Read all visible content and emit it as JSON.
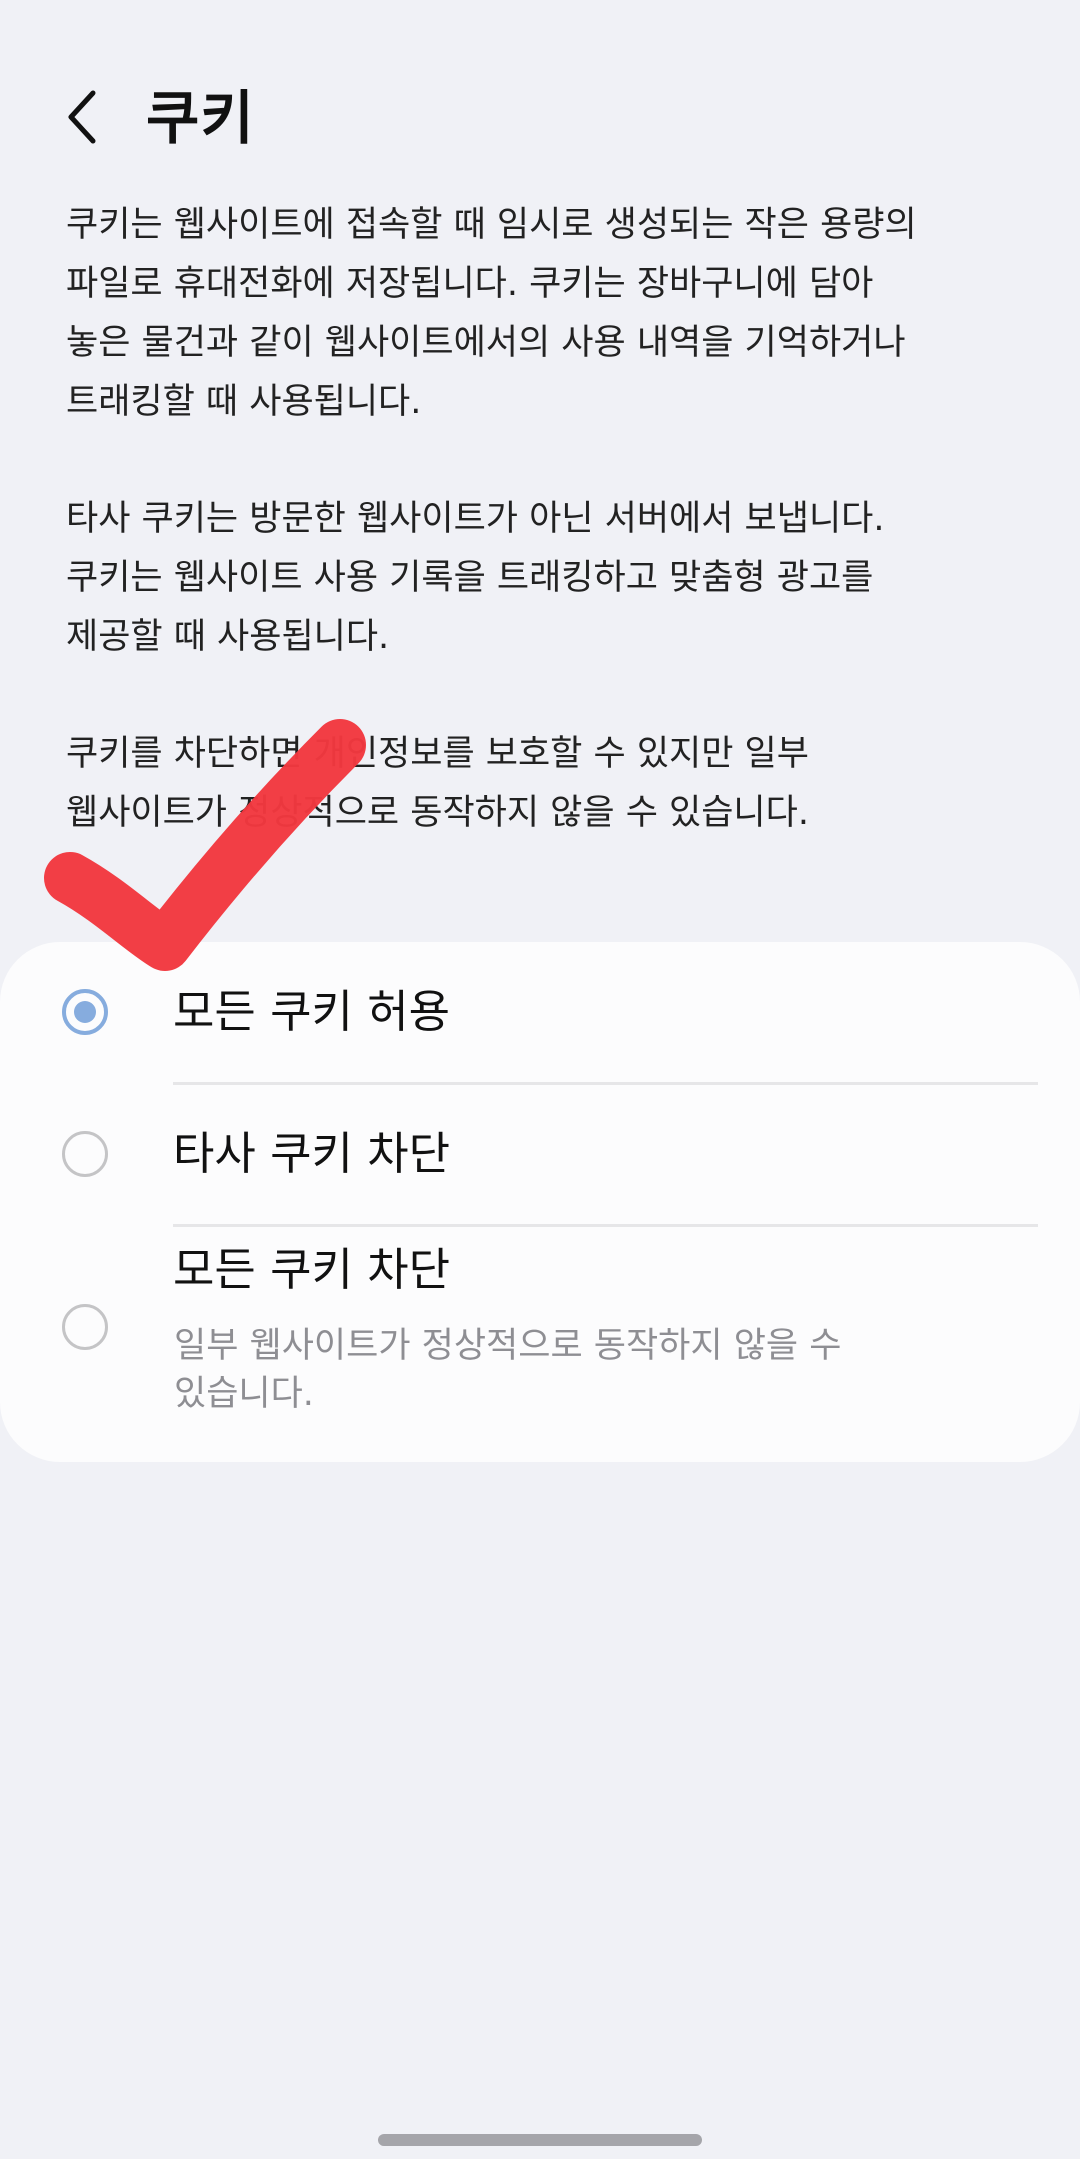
{
  "header": {
    "back_icon": "chevron-left-icon",
    "title": "쿠키"
  },
  "description": {
    "paragraph1": "쿠키는 웹사이트에 접속할 때 임시로 생성되는 작은 용량의\n파일로 휴대전화에 저장됩니다. 쿠키는 장바구니에 담아\n놓은 물건과 같이 웹사이트에서의 사용 내역을 기억하거나\n트래킹할 때 사용됩니다.",
    "paragraph2": "타사 쿠키는 방문한 웹사이트가 아닌 서버에서 보냅니다.\n쿠키는 웹사이트 사용 기록을 트래킹하고 맞춤형 광고를\n제공할 때 사용됩니다.",
    "paragraph3": "쿠키를 차단하면 개인정보를 보호할 수 있지만 일부\n웹사이트가 정상적으로 동작하지 않을 수 있습니다."
  },
  "options": [
    {
      "label": "모든 쿠키 허용",
      "selected": true
    },
    {
      "label": "타사 쿠키 차단",
      "selected": false
    },
    {
      "label": "모든 쿠키 차단",
      "sublabel": "일부 웹사이트가 정상적으로 동작하지 않을 수\n있습니다.",
      "selected": false
    }
  ],
  "annotation": {
    "icon": "checkmark-icon",
    "color": "#f2383f"
  },
  "colors": {
    "background": "#f0f1f6",
    "card": "#fcfcfd",
    "radio_selected": "#86acde",
    "radio_unselected": "#c4c4c6",
    "sublabel": "#8e8e93"
  }
}
